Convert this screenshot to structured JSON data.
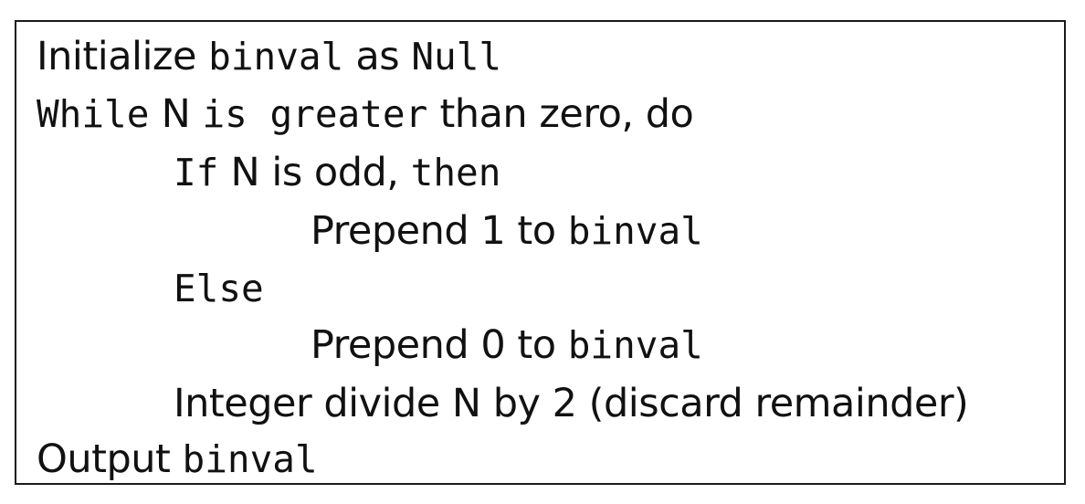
{
  "lines": [
    {
      "segments": [
        {
          "text": "Initialize ",
          "code": false
        },
        {
          "text": "binval",
          "code": true
        },
        {
          "text": " as ",
          "code": false
        },
        {
          "text": "Null",
          "code": true
        }
      ]
    },
    {
      "segments": [
        {
          "text": "While",
          "code": true
        },
        {
          "text": " N ",
          "code": false
        },
        {
          "text": "is greater",
          "code": true
        },
        {
          "text": " than zero, do",
          "code": false
        }
      ]
    },
    {
      "segments": [
        {
          "text": "If",
          "code": true
        },
        {
          "text": " N is odd, ",
          "code": false
        },
        {
          "text": "then",
          "code": true
        }
      ]
    },
    {
      "segments": [
        {
          "text": "Prepend 1 to ",
          "code": false
        },
        {
          "text": "binval",
          "code": true
        }
      ]
    },
    {
      "segments": [
        {
          "text": "Else",
          "code": true
        }
      ]
    },
    {
      "segments": [
        {
          "text": "Prepend 0 to ",
          "code": false
        },
        {
          "text": "binval",
          "code": true
        }
      ]
    },
    {
      "segments": [
        {
          "text": "Integer divide N by 2 (discard remainder)",
          "code": false
        }
      ]
    },
    {
      "segments": [
        {
          "text": "Output ",
          "code": false
        },
        {
          "text": "binval",
          "code": true
        }
      ]
    }
  ]
}
